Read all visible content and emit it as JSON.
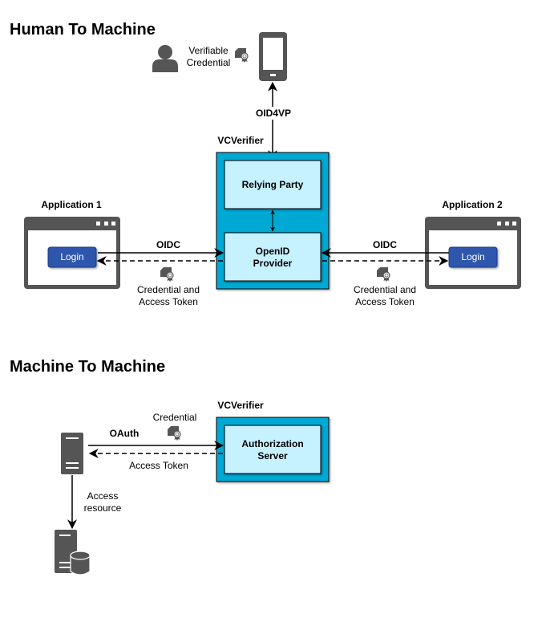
{
  "sections": {
    "human": {
      "title": "Human To Machine"
    },
    "machine": {
      "title": "Machine To Machine"
    }
  },
  "human": {
    "vc_label_line1": "Verifiable",
    "vc_label_line2": "Credential",
    "oid4vp": "OID4VP",
    "vcverifier": "VCVerifier",
    "relying_party": "Relying Party",
    "openid_line1": "OpenID",
    "openid_line2": "Provider",
    "app1": {
      "title": "Application 1",
      "login": "Login",
      "protocol": "OIDC",
      "return_line1": "Credential and",
      "return_line2": "Access Token"
    },
    "app2": {
      "title": "Application 2",
      "login": "Login",
      "protocol": "OIDC",
      "return_line1": "Credential and",
      "return_line2": "Access Token"
    }
  },
  "machine": {
    "vcverifier": "VCVerifier",
    "auth_line1": "Authorization",
    "auth_line2": "Server",
    "credential": "Credential",
    "protocol": "OAuth",
    "access_token": "Access Token",
    "access_line1": "Access",
    "access_line2": "resource"
  },
  "colors": {
    "container": "#00A9D4",
    "inner": "#C6F1FF",
    "icon": "#555555",
    "login": "#2F56AC"
  }
}
